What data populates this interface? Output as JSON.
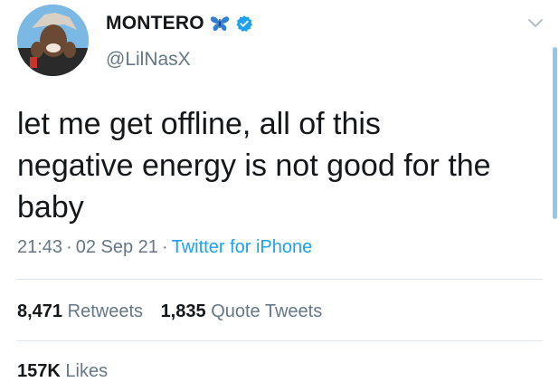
{
  "user": {
    "display_name": "MONTERO",
    "handle": "@LilNasX",
    "butterfly_color": "#2f7fd6",
    "verified_color": "#1da1f2"
  },
  "tweet": {
    "text": "let me get offline, all of this\nnegative energy is not good for the\nbaby"
  },
  "meta": {
    "time": "21:43",
    "separator": "·",
    "date": "02 Sep 21",
    "source": "Twitter for iPhone"
  },
  "stats": {
    "retweets_count": "8,471",
    "retweets_label": "Retweets",
    "quotes_count": "1,835",
    "quotes_label": "Quote Tweets",
    "likes_count": "157K",
    "likes_label": "Likes"
  },
  "colors": {
    "link": "#1da1f2",
    "secondary_text": "#657786",
    "divider": "#e1e8ed"
  }
}
